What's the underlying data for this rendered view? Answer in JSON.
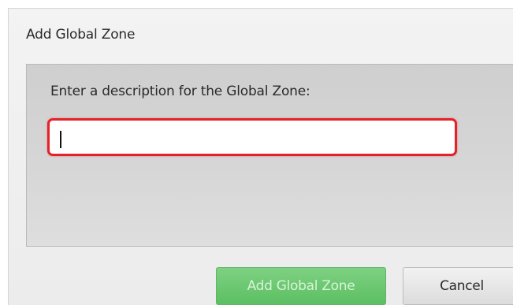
{
  "dialog": {
    "title": "Add Global Zone",
    "prompt": "Enter a description for the Global Zone:",
    "description_input": {
      "value": "",
      "placeholder": ""
    },
    "buttons": {
      "add_label": "Add Global Zone",
      "cancel_label": "Cancel"
    }
  },
  "colors": {
    "input_error_border": "#e4222a",
    "primary_button": "#6cc772",
    "secondary_button": "#e8e8e8"
  }
}
